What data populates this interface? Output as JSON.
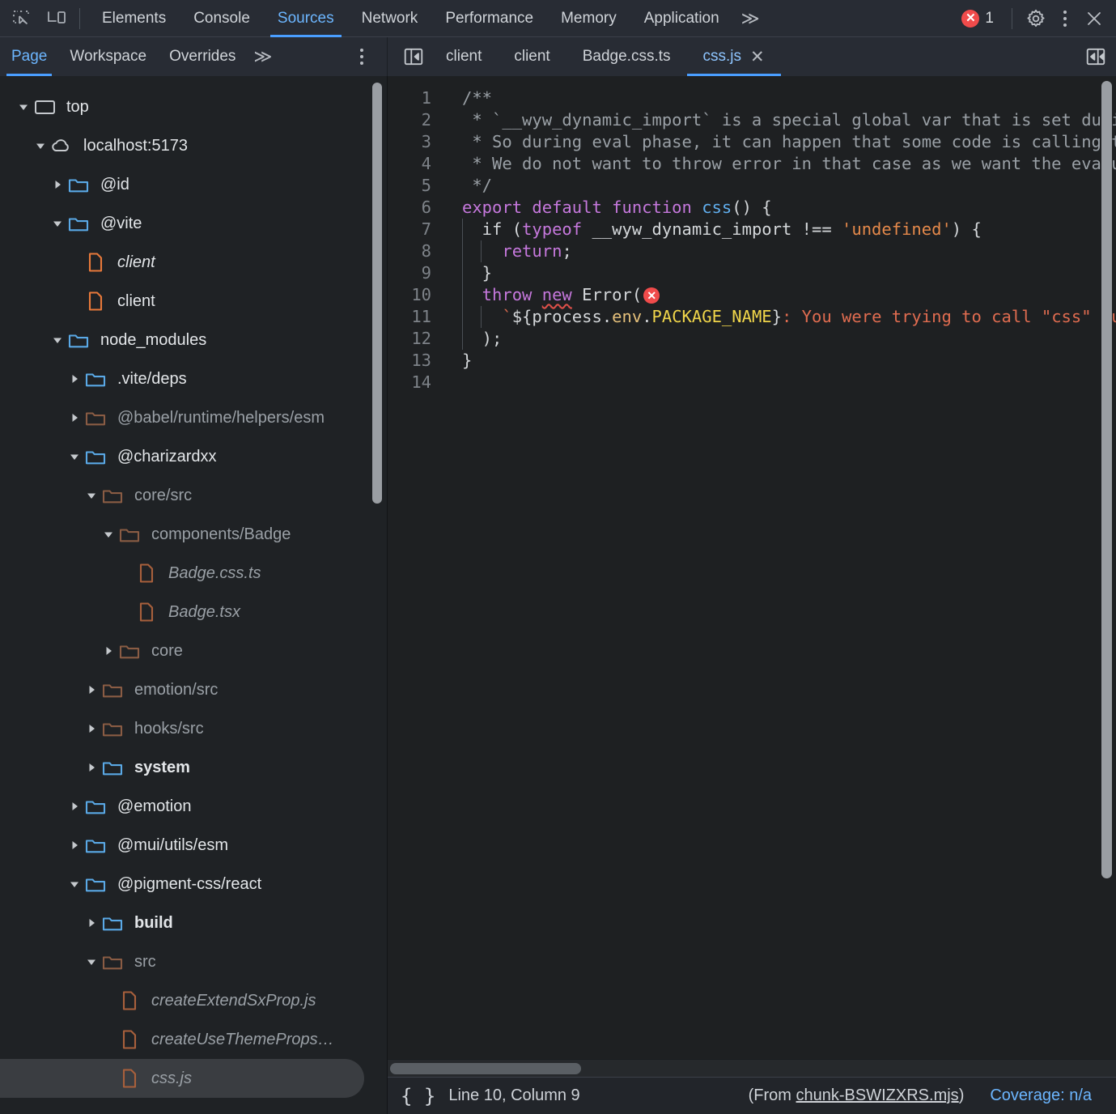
{
  "toolbar": {
    "inspect_icon": "inspect-element-icon",
    "device_icon": "device-toolbar-icon",
    "tabs": [
      {
        "label": "Elements",
        "active": false
      },
      {
        "label": "Console",
        "active": false
      },
      {
        "label": "Sources",
        "active": true
      },
      {
        "label": "Network",
        "active": false
      },
      {
        "label": "Performance",
        "active": false
      },
      {
        "label": "Memory",
        "active": false
      },
      {
        "label": "Application",
        "active": false
      }
    ],
    "more_tabs_glyph": "≫",
    "error_count": "1",
    "error_glyph": "✕",
    "settings_icon": "gear-icon",
    "menu_icon": "kebab-menu-icon",
    "close_icon": "close-icon",
    "close_glyph": "✕"
  },
  "navigator": {
    "subtabs": [
      {
        "label": "Page",
        "active": true
      },
      {
        "label": "Workspace",
        "active": false
      },
      {
        "label": "Overrides",
        "active": false
      }
    ],
    "more_glyph": "≫",
    "tree": [
      {
        "label": "top",
        "indent": 0,
        "twisty": "down",
        "icon": "frame",
        "state": "active",
        "style": "normal"
      },
      {
        "label": "localhost:5173",
        "indent": 1,
        "twisty": "down",
        "icon": "cloud",
        "state": "active",
        "style": "normal"
      },
      {
        "label": "@id",
        "indent": 2,
        "twisty": "right",
        "icon": "folder-blue",
        "state": "active",
        "style": "normal"
      },
      {
        "label": "@vite",
        "indent": 2,
        "twisty": "down",
        "icon": "folder-blue",
        "state": "active",
        "style": "normal"
      },
      {
        "label": "client",
        "indent": 3,
        "twisty": "none",
        "icon": "file-orange",
        "state": "active",
        "style": "italic"
      },
      {
        "label": "client",
        "indent": 3,
        "twisty": "none",
        "icon": "file-orange",
        "state": "active",
        "style": "normal"
      },
      {
        "label": "node_modules",
        "indent": 2,
        "twisty": "down",
        "icon": "folder-blue",
        "state": "active",
        "style": "normal"
      },
      {
        "label": ".vite/deps",
        "indent": 3,
        "twisty": "right",
        "icon": "folder-blue",
        "state": "active",
        "style": "normal"
      },
      {
        "label": "@babel/runtime/helpers/esm",
        "indent": 3,
        "twisty": "right",
        "icon": "folder-brown",
        "state": "dim",
        "style": "normal"
      },
      {
        "label": "@charizardxx",
        "indent": 3,
        "twisty": "down",
        "icon": "folder-blue",
        "state": "active",
        "style": "normal"
      },
      {
        "label": "core/src",
        "indent": 4,
        "twisty": "down",
        "icon": "folder-brown",
        "state": "dim",
        "style": "normal"
      },
      {
        "label": "components/Badge",
        "indent": 5,
        "twisty": "down",
        "icon": "folder-brown",
        "state": "dim",
        "style": "normal"
      },
      {
        "label": "Badge.css.ts",
        "indent": 6,
        "twisty": "none",
        "icon": "file-brown",
        "state": "dim",
        "style": "italic"
      },
      {
        "label": "Badge.tsx",
        "indent": 6,
        "twisty": "none",
        "icon": "file-brown",
        "state": "dim",
        "style": "italic"
      },
      {
        "label": "core",
        "indent": 5,
        "twisty": "right",
        "icon": "folder-brown",
        "state": "dim",
        "style": "normal"
      },
      {
        "label": "emotion/src",
        "indent": 4,
        "twisty": "right",
        "icon": "folder-brown",
        "state": "dim",
        "style": "normal"
      },
      {
        "label": "hooks/src",
        "indent": 4,
        "twisty": "right",
        "icon": "folder-brown",
        "state": "dim",
        "style": "normal"
      },
      {
        "label": "system",
        "indent": 4,
        "twisty": "right",
        "icon": "folder-blue",
        "state": "active",
        "style": "bold"
      },
      {
        "label": "@emotion",
        "indent": 3,
        "twisty": "right",
        "icon": "folder-blue",
        "state": "active",
        "style": "normal"
      },
      {
        "label": "@mui/utils/esm",
        "indent": 3,
        "twisty": "right",
        "icon": "folder-blue",
        "state": "active",
        "style": "normal"
      },
      {
        "label": "@pigment-css/react",
        "indent": 3,
        "twisty": "down",
        "icon": "folder-blue",
        "state": "active",
        "style": "normal"
      },
      {
        "label": "build",
        "indent": 4,
        "twisty": "right",
        "icon": "folder-blue",
        "state": "active",
        "style": "bold"
      },
      {
        "label": "src",
        "indent": 4,
        "twisty": "down",
        "icon": "folder-brown",
        "state": "dim",
        "style": "normal"
      },
      {
        "label": "createExtendSxProp.js",
        "indent": 5,
        "twisty": "none",
        "icon": "file-brown",
        "state": "dim",
        "style": "italic"
      },
      {
        "label": "createUseThemeProps…",
        "indent": 5,
        "twisty": "none",
        "icon": "file-brown",
        "state": "dim",
        "style": "italic"
      },
      {
        "label": "css.js",
        "indent": 5,
        "twisty": "none",
        "icon": "file-brown",
        "state": "dim",
        "style": "italic",
        "selected": true
      }
    ]
  },
  "editor": {
    "navigator_toggle_icon": "show-navigator-icon",
    "sidebar_toggle_icon": "show-debugger-icon",
    "tabs": [
      {
        "label": "client",
        "active": false
      },
      {
        "label": "client",
        "active": false
      },
      {
        "label": "Badge.css.ts",
        "active": false
      },
      {
        "label": "css.js",
        "active": true,
        "closable": true
      }
    ],
    "close_glyph": "✕",
    "line_numbers": [
      "1",
      "2",
      "3",
      "4",
      "5",
      "6",
      "7",
      "8",
      "9",
      "10",
      "11",
      "12",
      "13",
      "14"
    ],
    "code_lines": [
      {
        "n": "1",
        "segments": [
          {
            "t": "/**",
            "c": "cm"
          }
        ]
      },
      {
        "n": "2",
        "segments": [
          {
            "t": " * `__wyw_dynamic_import` is a special global var that is set durin",
            "c": "cm"
          }
        ]
      },
      {
        "n": "3",
        "segments": [
          {
            "t": " * So during eval phase, it can happen that some code is calling th",
            "c": "cm"
          }
        ]
      },
      {
        "n": "4",
        "segments": [
          {
            "t": " * We do not want to throw error in that case as we want the evalua",
            "c": "cm"
          }
        ]
      },
      {
        "n": "5",
        "segments": [
          {
            "t": " */",
            "c": "cm"
          }
        ]
      },
      {
        "n": "6",
        "segments": [
          {
            "t": "export default function ",
            "c": "kw"
          },
          {
            "t": "css",
            "c": "fn"
          },
          {
            "t": "() {",
            "c": "pl"
          }
        ]
      },
      {
        "n": "7",
        "segments": [
          {
            "t": "  if (",
            "c": "pl"
          },
          {
            "t": "typeof",
            "c": "kw"
          },
          {
            "t": " __wyw_dynamic_import !== ",
            "c": "pl"
          },
          {
            "t": "'undefined'",
            "c": "str"
          },
          {
            "t": ") {",
            "c": "pl"
          }
        ]
      },
      {
        "n": "8",
        "segments": [
          {
            "t": "    ",
            "c": "pl"
          },
          {
            "t": "return",
            "c": "kw"
          },
          {
            "t": ";",
            "c": "pl"
          }
        ]
      },
      {
        "n": "9",
        "segments": [
          {
            "t": "  }",
            "c": "pl"
          }
        ]
      },
      {
        "n": "10",
        "segments": [
          {
            "t": "  throw ",
            "c": "kw"
          },
          {
            "t": "new",
            "c": "kw-err"
          },
          {
            "t": " Error(",
            "c": "pl"
          },
          {
            "t": "✕",
            "c": "badge"
          }
        ]
      },
      {
        "n": "11",
        "segments": [
          {
            "t": "    `",
            "c": "tmpl"
          },
          {
            "t": "${",
            "c": "pl"
          },
          {
            "t": "process",
            "c": "pl"
          },
          {
            "t": ".",
            "c": "pl"
          },
          {
            "t": "env",
            "c": "yel"
          },
          {
            "t": ".",
            "c": "pl"
          },
          {
            "t": "PACKAGE_NAME",
            "c": "yel2"
          },
          {
            "t": "}",
            "c": "pl"
          },
          {
            "t": ": You were trying to call \"css\" fun",
            "c": "tmpl"
          }
        ]
      },
      {
        "n": "12",
        "segments": [
          {
            "t": "  );",
            "c": "pl"
          }
        ]
      },
      {
        "n": "13",
        "segments": [
          {
            "t": "}",
            "c": "pl"
          }
        ]
      },
      {
        "n": "14",
        "segments": []
      }
    ]
  },
  "status": {
    "pretty_print_icon": "pretty-print-icon",
    "pretty_print_glyph": "{ }",
    "position": "Line 10, Column 9",
    "from_prefix": "(From ",
    "from_link": "chunk-BSWIZXRS.mjs",
    "from_suffix": ")",
    "coverage": "Coverage: n/a"
  },
  "colors": {
    "accent": "#4a9eff",
    "accent_text": "#6cb6ff",
    "error": "#f04b4b",
    "folder_blue": "#5aa9e6",
    "folder_brown": "#8a5c44",
    "file_orange": "#e8793a",
    "file_brown": "#a8603c"
  }
}
